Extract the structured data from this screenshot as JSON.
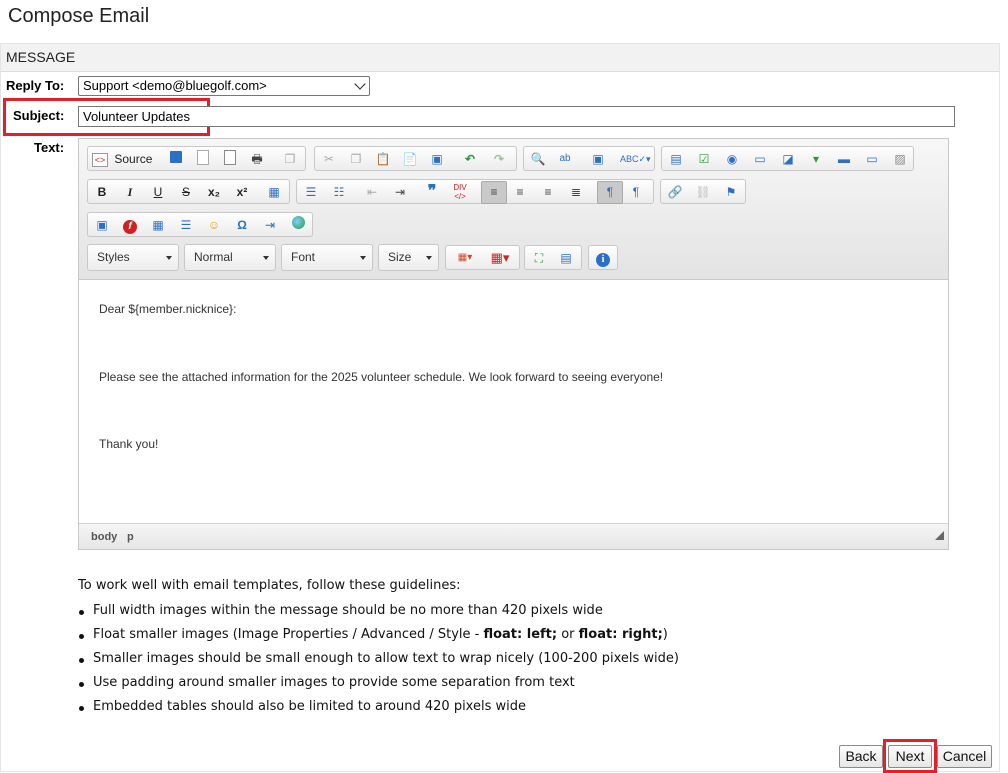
{
  "page": {
    "title": "Compose Email"
  },
  "panel": {
    "header": "MESSAGE"
  },
  "form": {
    "reply_to_label": "Reply To:",
    "reply_to_value": "Support <demo@bluegolf.com>",
    "subject_label": "Subject:",
    "subject_value": "Volunteer Updates",
    "text_label": "Text:"
  },
  "toolbar": {
    "source_label": "Source",
    "styles_combo": "Styles",
    "format_combo": "Normal",
    "font_combo": "Font",
    "size_combo": "Size",
    "bold": "B",
    "italic": "I",
    "underline": "U",
    "strike": "S",
    "subscript": "x₂",
    "superscript": "x²",
    "omega": "Ω"
  },
  "editor": {
    "lines": [
      "Dear ${member.nicknice}:",
      "Please see the attached information for the 2025 volunteer schedule. We look forward to seeing everyone!",
      "Thank you!"
    ],
    "path": [
      "body",
      "p"
    ]
  },
  "guidelines": {
    "intro": "To work well with email templates, follow these guidelines:",
    "items": [
      "Full width images within the message should be no more than 420 pixels wide",
      "Smaller images should be small enough to allow text to wrap nicely (100-200 pixels wide)",
      "Use padding around smaller images to provide some separation from text",
      "Embedded tables should also be limited to around 420 pixels wide"
    ],
    "float_item": {
      "prefix": "Float smaller images (Image Properties / Advanced / Style - ",
      "bold1": "float: left;",
      "middle": " or ",
      "bold2": "float: right;",
      "suffix": ")"
    }
  },
  "footer": {
    "back": "Back",
    "next": "Next",
    "cancel": "Cancel"
  },
  "colors": {
    "highlight": "#e0202a",
    "accent_blue": "#2d6fc4"
  }
}
